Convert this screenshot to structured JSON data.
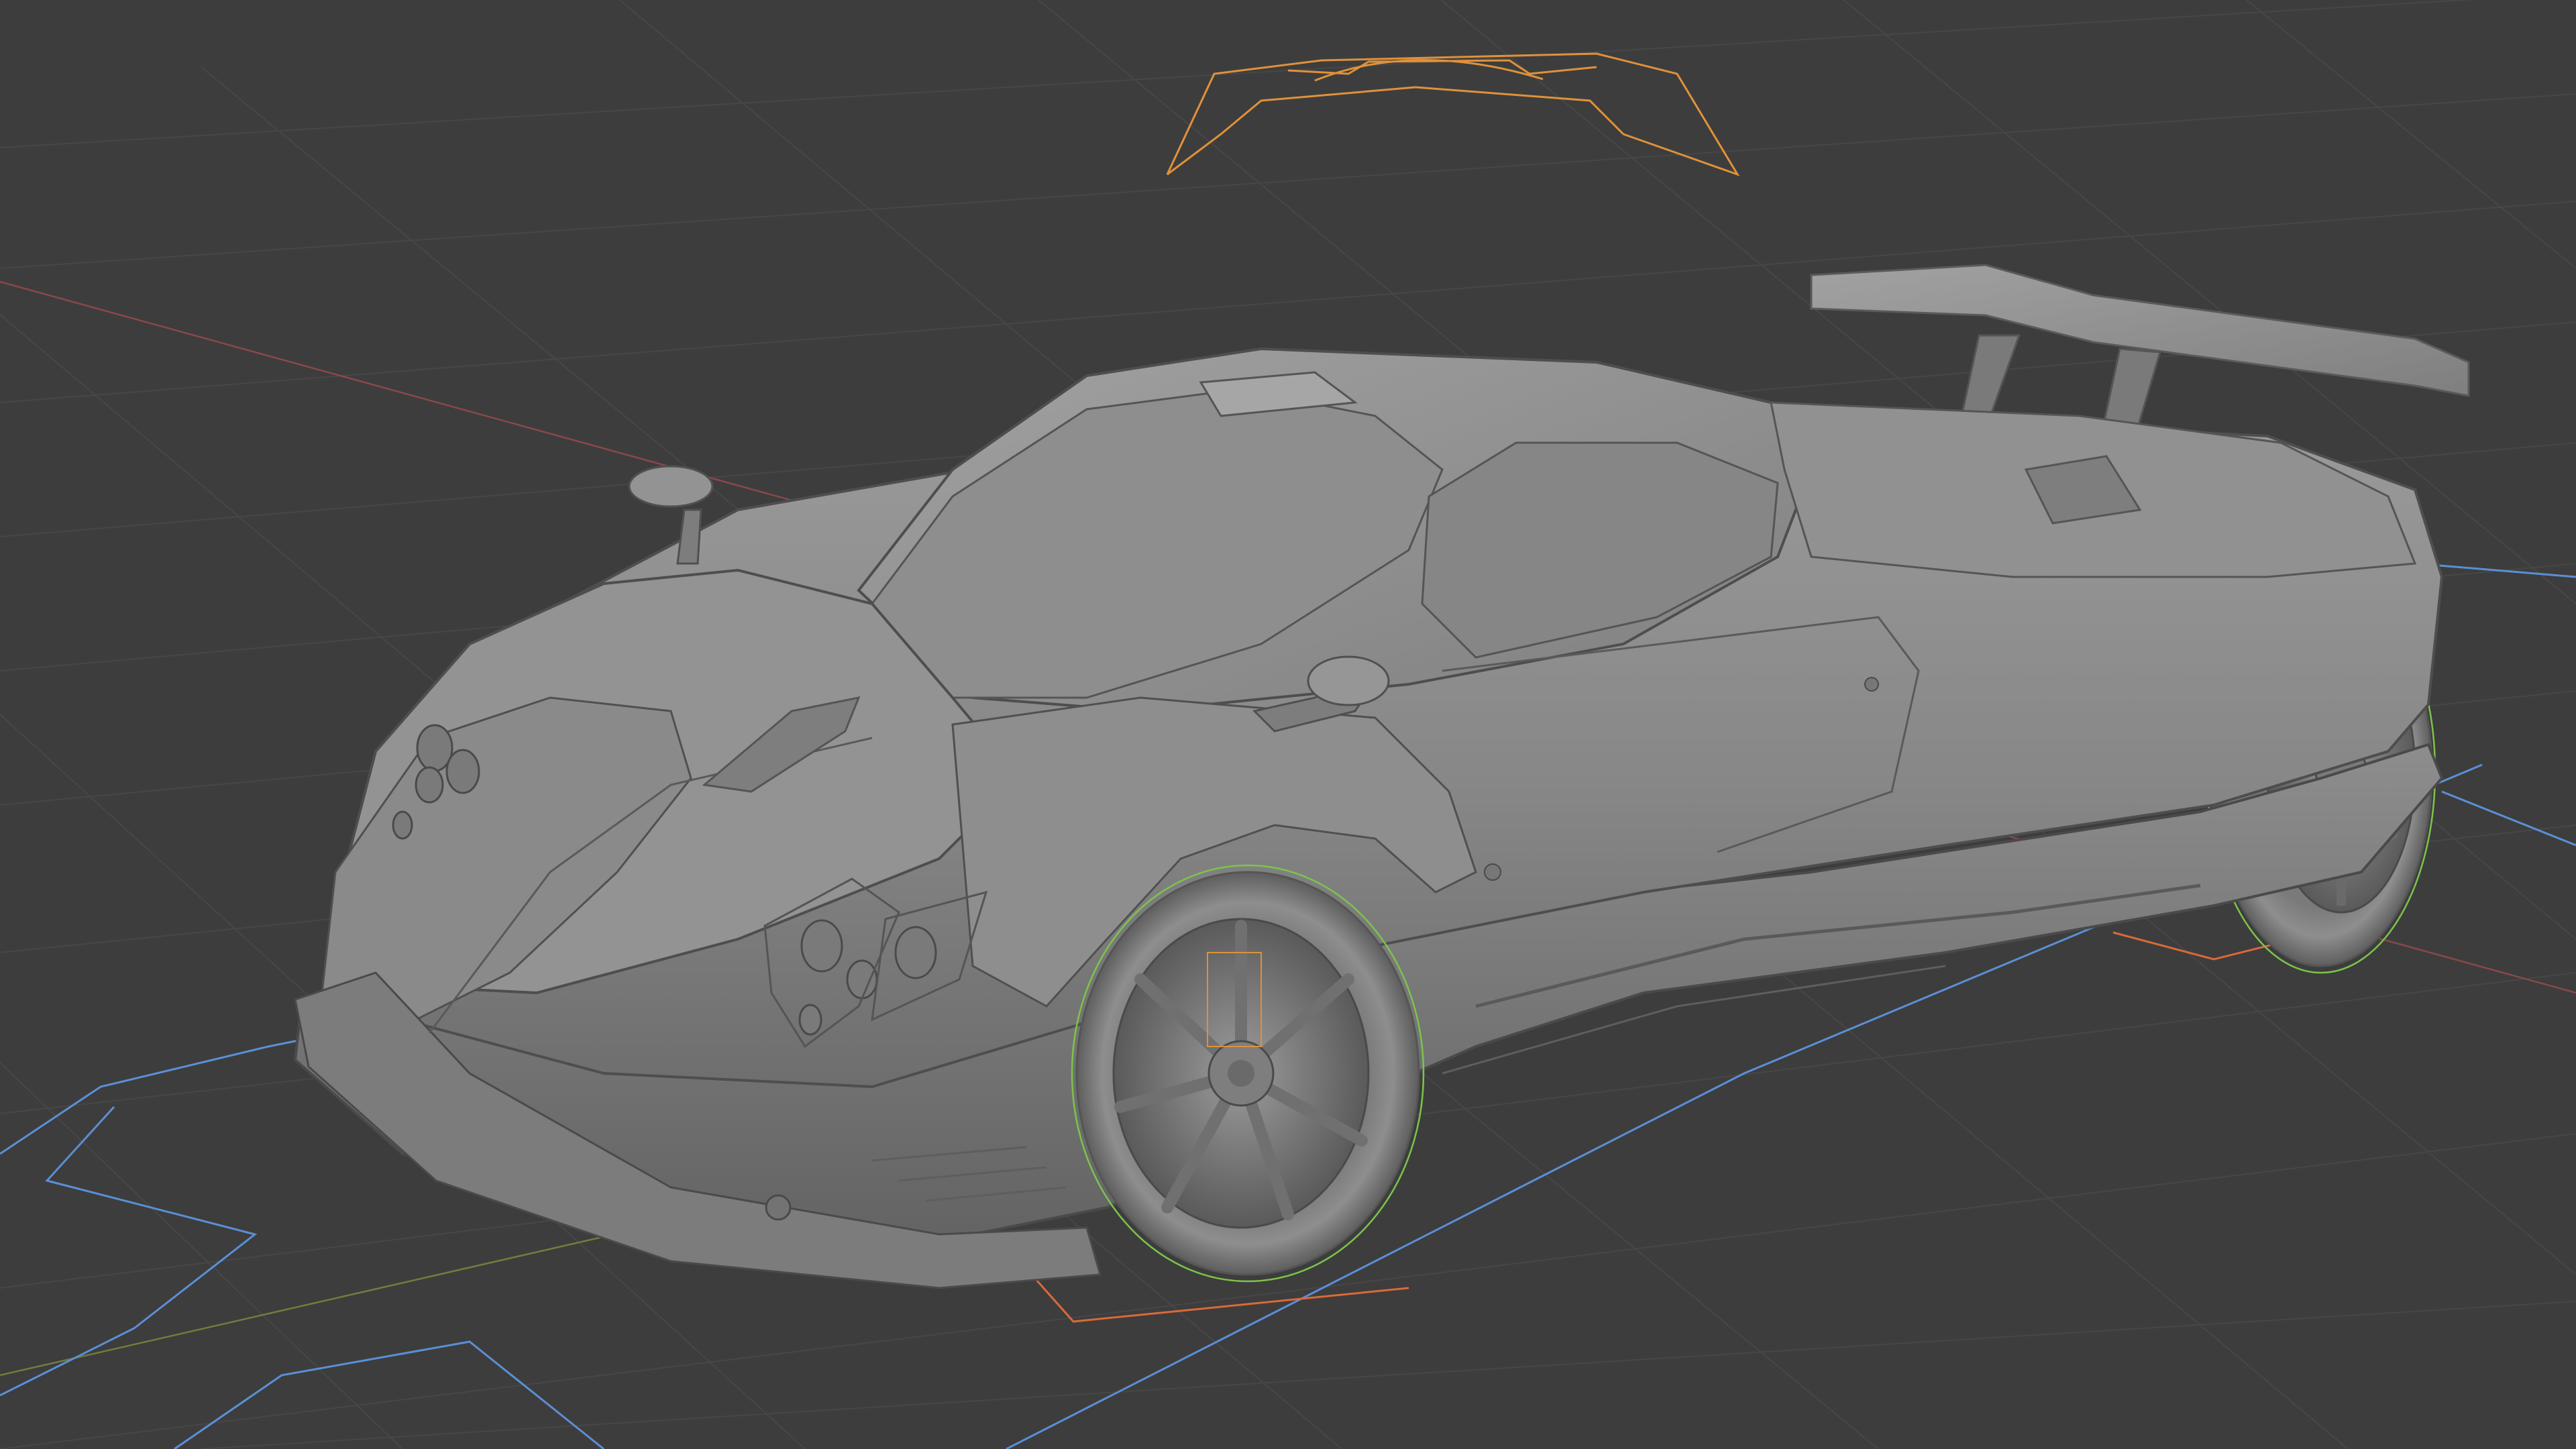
{
  "app": {
    "type": "3d-viewport",
    "shading_mode": "solid",
    "background_color": "#3d3d3d"
  },
  "viewport": {
    "grid": true,
    "grid_color": "#474747",
    "x_axis_color": "#b85050",
    "y_axis_color": "#7a9a3a",
    "object_name": "sports-car-model",
    "object_color": "#8c8c8c",
    "selection_outline_color": "#e0913a",
    "rig_control_color": "#5b8fd6",
    "wheel_control_color": "#7cc44a"
  }
}
